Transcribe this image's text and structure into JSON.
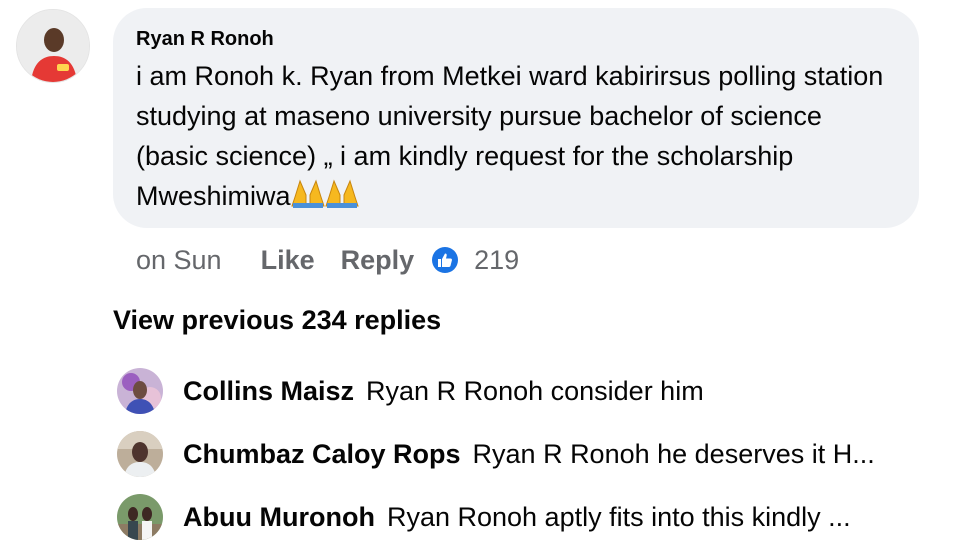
{
  "comment": {
    "author": "Ryan R Ronoh",
    "text": "i am  Ronoh k. Ryan  from Metkei ward kabirirsus polling station studying at maseno university pursue bachelor of science (basic science)  „ i am kindly request for the scholarship Mweshimiwa",
    "emoji": "folded-hands-icon",
    "time": "on Sun",
    "like_label": "Like",
    "reply_label": "Reply",
    "reaction_icon": "thumbs-up-icon",
    "reaction_count": "219"
  },
  "view_previous": "View previous 234 replies",
  "replies": [
    {
      "author": "Collins Maisz",
      "text": "Ryan R Ronoh consider him"
    },
    {
      "author": "Chumbaz Caloy Rops",
      "text": "Ryan R Ronoh he deserves it H..."
    },
    {
      "author": "Abuu Muronoh",
      "text": "Ryan Ronoh aptly fits into this kindly ..."
    }
  ],
  "colors": {
    "bubble": "#f0f2f5",
    "muted_text": "#65676b",
    "like_blue": "#1b74e4",
    "text": "#050505"
  }
}
